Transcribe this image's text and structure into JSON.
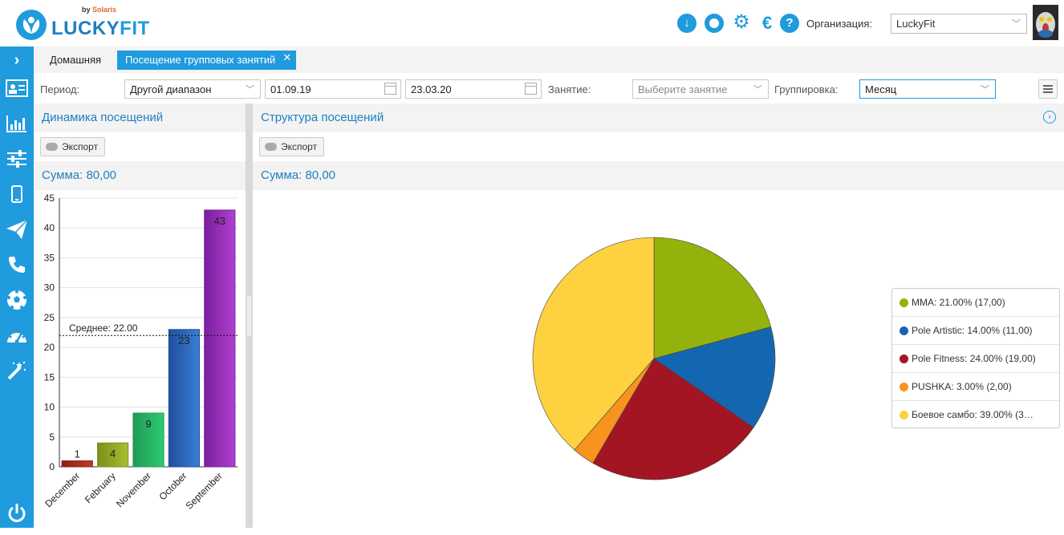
{
  "brand": {
    "name_part1": "LUCKY",
    "name_part2": "FIT",
    "by": "by",
    "vendor": "Solaris"
  },
  "header": {
    "icons": [
      "download-icon",
      "lifebuoy-icon",
      "gear-icon",
      "euro-icon",
      "help-icon"
    ],
    "org_label": "Организация:",
    "org_value": "LuckyFit"
  },
  "sidebar": {
    "items": [
      "expand-icon",
      "contact-card-icon",
      "bar-chart-icon",
      "sliders-icon",
      "mobile-icon",
      "send-icon",
      "phone-icon",
      "ball-icon",
      "dashboard-icon",
      "magic-wand-icon",
      "power-icon"
    ]
  },
  "tabs": [
    {
      "label": "Домашняя",
      "active": false
    },
    {
      "label": "Посещение групповых занятий",
      "active": true
    }
  ],
  "filters": {
    "period_label": "Период:",
    "period_value": "Другой диапазон",
    "date_from": "01.09.19",
    "date_to": "23.03.20",
    "class_label": "Занятие:",
    "class_placeholder": "Выберите занятие",
    "group_label": "Группировка:",
    "group_value": "Месяц"
  },
  "left_panel": {
    "title": "Динамика посещений",
    "export_label": "Экспорт",
    "sum_text": "Сумма: 80,00"
  },
  "right_panel": {
    "title": "Структура посещений",
    "export_label": "Экспорт",
    "sum_text": "Сумма: 80,00"
  },
  "chart_data": [
    {
      "type": "bar",
      "categories": [
        "December",
        "February",
        "November",
        "October",
        "September"
      ],
      "values": [
        1,
        4,
        9,
        23,
        43
      ],
      "ylim": [
        0,
        45
      ],
      "yticks": [
        0,
        5,
        10,
        15,
        20,
        25,
        30,
        35,
        40,
        45
      ],
      "grid": true,
      "average": 22,
      "average_label": "Среднее: 22.00",
      "colors": [
        [
          "#c0392b",
          "#8e1f17"
        ],
        [
          "#a8c030",
          "#7a8f1a"
        ],
        [
          "#2ecc71",
          "#1f9955"
        ],
        [
          "#3a7fd5",
          "#1f4f9e"
        ],
        [
          "#b040d0",
          "#7a1f9e"
        ]
      ]
    },
    {
      "type": "pie",
      "slices": [
        {
          "label": "MMA",
          "percent": 21.0,
          "value": 17,
          "legend": "MMA: 21.00% (17,00)",
          "color": "#94b20c"
        },
        {
          "label": "Pole Artistic",
          "percent": 14.0,
          "value": 11,
          "legend": "Pole Artistic: 14.00% (11,00)",
          "color": "#1566b0"
        },
        {
          "label": "Pole Fitness",
          "percent": 24.0,
          "value": 19,
          "legend": "Pole Fitness: 24.00% (19,00)",
          "color": "#a31522"
        },
        {
          "label": "PUSHKA",
          "percent": 3.0,
          "value": 2,
          "legend": "PUSHKA: 3.00% (2,00)",
          "color": "#f7931e"
        },
        {
          "label": "Боевое самбо",
          "percent": 39.0,
          "value": 31,
          "legend": "Боевое самбо: 39.00% (3…",
          "color": "#fdd140"
        }
      ],
      "legend_position": "right"
    }
  ]
}
